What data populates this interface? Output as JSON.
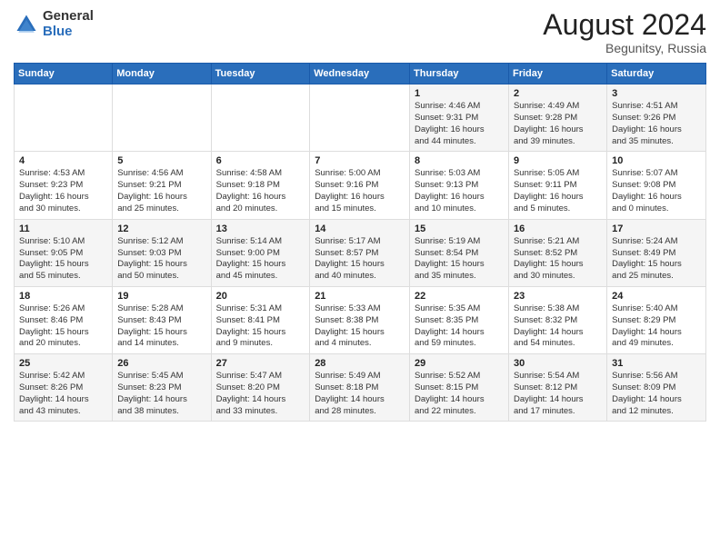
{
  "header": {
    "logo_general": "General",
    "logo_blue": "Blue",
    "month_year": "August 2024",
    "location": "Begunitsy, Russia"
  },
  "days_of_week": [
    "Sunday",
    "Monday",
    "Tuesday",
    "Wednesday",
    "Thursday",
    "Friday",
    "Saturday"
  ],
  "weeks": [
    [
      {
        "day": "",
        "content": ""
      },
      {
        "day": "",
        "content": ""
      },
      {
        "day": "",
        "content": ""
      },
      {
        "day": "",
        "content": ""
      },
      {
        "day": "1",
        "content": "Sunrise: 4:46 AM\nSunset: 9:31 PM\nDaylight: 16 hours\nand 44 minutes."
      },
      {
        "day": "2",
        "content": "Sunrise: 4:49 AM\nSunset: 9:28 PM\nDaylight: 16 hours\nand 39 minutes."
      },
      {
        "day": "3",
        "content": "Sunrise: 4:51 AM\nSunset: 9:26 PM\nDaylight: 16 hours\nand 35 minutes."
      }
    ],
    [
      {
        "day": "4",
        "content": "Sunrise: 4:53 AM\nSunset: 9:23 PM\nDaylight: 16 hours\nand 30 minutes."
      },
      {
        "day": "5",
        "content": "Sunrise: 4:56 AM\nSunset: 9:21 PM\nDaylight: 16 hours\nand 25 minutes."
      },
      {
        "day": "6",
        "content": "Sunrise: 4:58 AM\nSunset: 9:18 PM\nDaylight: 16 hours\nand 20 minutes."
      },
      {
        "day": "7",
        "content": "Sunrise: 5:00 AM\nSunset: 9:16 PM\nDaylight: 16 hours\nand 15 minutes."
      },
      {
        "day": "8",
        "content": "Sunrise: 5:03 AM\nSunset: 9:13 PM\nDaylight: 16 hours\nand 10 minutes."
      },
      {
        "day": "9",
        "content": "Sunrise: 5:05 AM\nSunset: 9:11 PM\nDaylight: 16 hours\nand 5 minutes."
      },
      {
        "day": "10",
        "content": "Sunrise: 5:07 AM\nSunset: 9:08 PM\nDaylight: 16 hours\nand 0 minutes."
      }
    ],
    [
      {
        "day": "11",
        "content": "Sunrise: 5:10 AM\nSunset: 9:05 PM\nDaylight: 15 hours\nand 55 minutes."
      },
      {
        "day": "12",
        "content": "Sunrise: 5:12 AM\nSunset: 9:03 PM\nDaylight: 15 hours\nand 50 minutes."
      },
      {
        "day": "13",
        "content": "Sunrise: 5:14 AM\nSunset: 9:00 PM\nDaylight: 15 hours\nand 45 minutes."
      },
      {
        "day": "14",
        "content": "Sunrise: 5:17 AM\nSunset: 8:57 PM\nDaylight: 15 hours\nand 40 minutes."
      },
      {
        "day": "15",
        "content": "Sunrise: 5:19 AM\nSunset: 8:54 PM\nDaylight: 15 hours\nand 35 minutes."
      },
      {
        "day": "16",
        "content": "Sunrise: 5:21 AM\nSunset: 8:52 PM\nDaylight: 15 hours\nand 30 minutes."
      },
      {
        "day": "17",
        "content": "Sunrise: 5:24 AM\nSunset: 8:49 PM\nDaylight: 15 hours\nand 25 minutes."
      }
    ],
    [
      {
        "day": "18",
        "content": "Sunrise: 5:26 AM\nSunset: 8:46 PM\nDaylight: 15 hours\nand 20 minutes."
      },
      {
        "day": "19",
        "content": "Sunrise: 5:28 AM\nSunset: 8:43 PM\nDaylight: 15 hours\nand 14 minutes."
      },
      {
        "day": "20",
        "content": "Sunrise: 5:31 AM\nSunset: 8:41 PM\nDaylight: 15 hours\nand 9 minutes."
      },
      {
        "day": "21",
        "content": "Sunrise: 5:33 AM\nSunset: 8:38 PM\nDaylight: 15 hours\nand 4 minutes."
      },
      {
        "day": "22",
        "content": "Sunrise: 5:35 AM\nSunset: 8:35 PM\nDaylight: 14 hours\nand 59 minutes."
      },
      {
        "day": "23",
        "content": "Sunrise: 5:38 AM\nSunset: 8:32 PM\nDaylight: 14 hours\nand 54 minutes."
      },
      {
        "day": "24",
        "content": "Sunrise: 5:40 AM\nSunset: 8:29 PM\nDaylight: 14 hours\nand 49 minutes."
      }
    ],
    [
      {
        "day": "25",
        "content": "Sunrise: 5:42 AM\nSunset: 8:26 PM\nDaylight: 14 hours\nand 43 minutes."
      },
      {
        "day": "26",
        "content": "Sunrise: 5:45 AM\nSunset: 8:23 PM\nDaylight: 14 hours\nand 38 minutes."
      },
      {
        "day": "27",
        "content": "Sunrise: 5:47 AM\nSunset: 8:20 PM\nDaylight: 14 hours\nand 33 minutes."
      },
      {
        "day": "28",
        "content": "Sunrise: 5:49 AM\nSunset: 8:18 PM\nDaylight: 14 hours\nand 28 minutes."
      },
      {
        "day": "29",
        "content": "Sunrise: 5:52 AM\nSunset: 8:15 PM\nDaylight: 14 hours\nand 22 minutes."
      },
      {
        "day": "30",
        "content": "Sunrise: 5:54 AM\nSunset: 8:12 PM\nDaylight: 14 hours\nand 17 minutes."
      },
      {
        "day": "31",
        "content": "Sunrise: 5:56 AM\nSunset: 8:09 PM\nDaylight: 14 hours\nand 12 minutes."
      }
    ]
  ]
}
